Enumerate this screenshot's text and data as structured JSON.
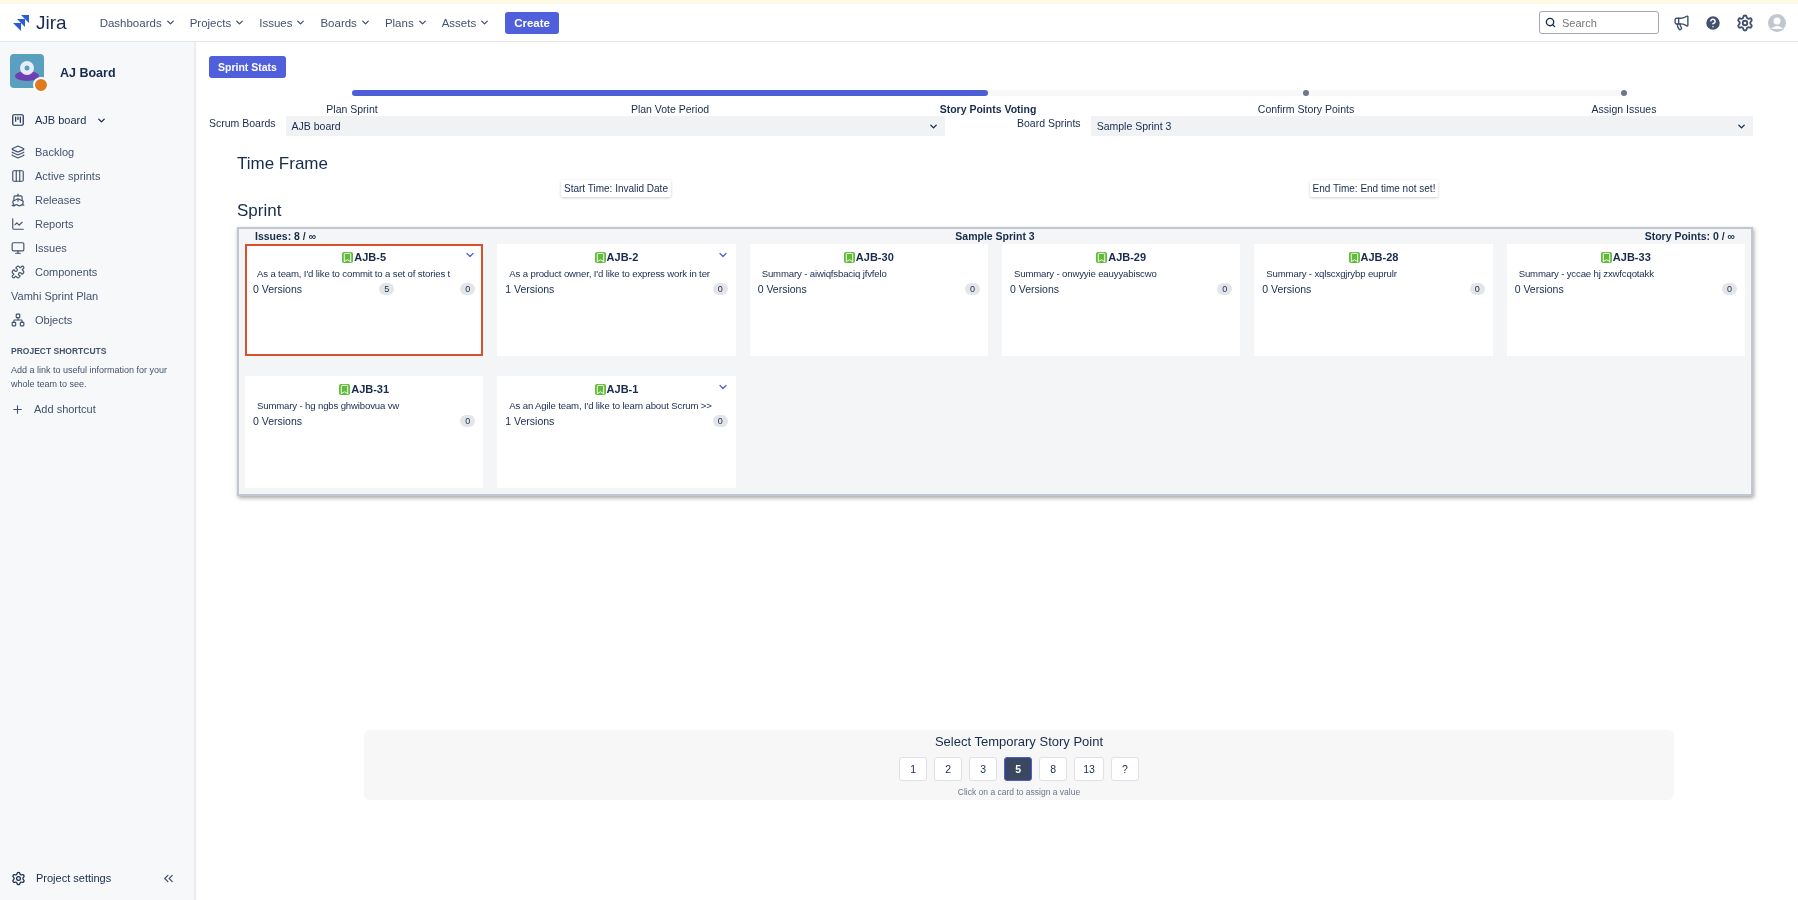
{
  "topnav": {
    "logo": "Jira",
    "menus": [
      "Dashboards",
      "Projects",
      "Issues",
      "Boards",
      "Plans",
      "Assets"
    ],
    "create": "Create",
    "search": {
      "placeholder": "Search"
    }
  },
  "sidebar": {
    "project": "AJ Board",
    "board": "AJB board",
    "items": [
      {
        "kind": "backlog",
        "label": "Backlog"
      },
      {
        "kind": "sprints",
        "label": "Active sprints"
      },
      {
        "kind": "releases",
        "label": "Releases"
      },
      {
        "kind": "reports",
        "label": "Reports"
      },
      {
        "kind": "issues",
        "label": "Issues"
      },
      {
        "kind": "components",
        "label": "Components"
      },
      {
        "kind": "plain",
        "label": "Vamhi Sprint Plan"
      },
      {
        "kind": "objects",
        "label": "Objects"
      }
    ],
    "shortcuts_heading": "PROJECT SHORTCUTS",
    "shortcuts_text": "Add a link to useful information for your whole team to see.",
    "add_shortcut": "Add shortcut",
    "settings": "Project settings"
  },
  "stats_button": "Sprint Stats",
  "progress": {
    "level": 0.5
  },
  "steps": [
    {
      "label": "Plan Sprint",
      "selected": false
    },
    {
      "label": "Plan Vote Period",
      "selected": false
    },
    {
      "label": "Story Points Voting",
      "selected": true
    },
    {
      "label": "Confirm Story Points",
      "selected": false
    },
    {
      "label": "Assign Issues",
      "selected": false
    }
  ],
  "filters": [
    {
      "label": "Scrum Boards",
      "value": "AJB board"
    },
    {
      "label": "Board Sprints",
      "value": "Sample Sprint 3"
    }
  ],
  "time_frame": {
    "heading": "Time Frame",
    "start": "Start Time: Invalid Date",
    "end": "End Time: End time not set!"
  },
  "sprint": {
    "heading": "Sprint",
    "issues": "Issues: 8 / ∞",
    "name": "Sample Sprint 3",
    "points": "Story Points: 0 / ∞",
    "cards": [
      {
        "key": "AJB-5",
        "summary": "As a team, I'd like to commit to a set of stories t",
        "versions": "0 Versions",
        "vote": "5",
        "points": "0",
        "menu": true,
        "selected": true
      },
      {
        "key": "AJB-2",
        "summary": "As a product owner, I'd like to express work in ter",
        "versions": "1 Versions",
        "points": "0",
        "menu": true,
        "selected": false
      },
      {
        "key": "AJB-30",
        "summary": "Summary - aiwiqfsbaciq jfvfelo",
        "versions": "0 Versions",
        "points": "0",
        "menu": false,
        "selected": false
      },
      {
        "key": "AJB-29",
        "summary": "Summary - onwyyie eauyyabiscwo",
        "versions": "0 Versions",
        "points": "0",
        "menu": false,
        "selected": false
      },
      {
        "key": "AJB-28",
        "summary": "Summary - xqlscxgjrybp euprulr",
        "versions": "0 Versions",
        "points": "0",
        "menu": false,
        "selected": false
      },
      {
        "key": "AJB-33",
        "summary": "Summary - yccae hj zxwfcqotakk",
        "versions": "0 Versions",
        "points": "0",
        "menu": false,
        "selected": false
      },
      {
        "key": "AJB-31",
        "summary": "Summary - hg ngbs ghwibovua vw",
        "versions": "0 Versions",
        "points": "0",
        "menu": false,
        "selected": false
      },
      {
        "key": "AJB-1",
        "summary": "As an Agile team, I'd like to learn about Scrum >>",
        "versions": "1 Versions",
        "points": "0",
        "menu": true,
        "selected": false
      }
    ]
  },
  "picker": {
    "title": "Select Temporary Story Point",
    "hint": "Click on a card to assign a value",
    "options": [
      {
        "label": "1",
        "selected": false
      },
      {
        "label": "2",
        "selected": false
      },
      {
        "label": "3",
        "selected": false
      },
      {
        "label": "5",
        "selected": true
      },
      {
        "label": "8",
        "selected": false
      },
      {
        "label": "13",
        "selected": false
      },
      {
        "label": "?",
        "selected": false
      }
    ]
  }
}
